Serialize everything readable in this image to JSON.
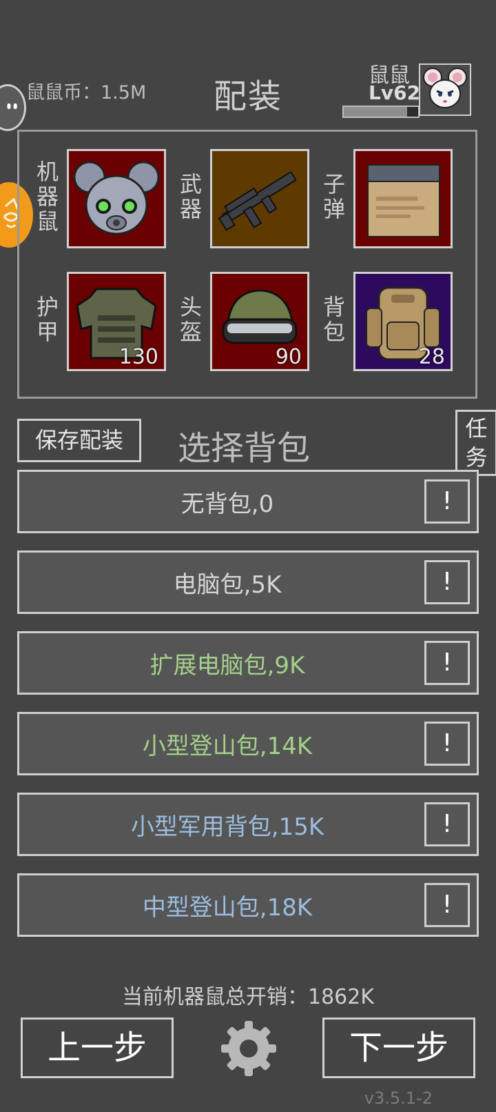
{
  "header": {
    "coins_label": "鼠鼠币：1.5M",
    "title": "配装",
    "player_name": "鼠鼠",
    "player_level": "Lv62",
    "xp_progress": 0.85
  },
  "loadout": {
    "slots": [
      {
        "label": "机器鼠",
        "icon": "robot-mouse-head-icon",
        "bg": "#6b0000",
        "count": ""
      },
      {
        "label": "武器",
        "icon": "assault-rifle-icon",
        "bg": "#5e3a00",
        "count": ""
      },
      {
        "label": "子弹",
        "icon": "ammo-box-icon",
        "bg": "#6b0000",
        "count": ""
      },
      {
        "label": "护甲",
        "icon": "body-armor-icon",
        "bg": "#6b0000",
        "count": "130"
      },
      {
        "label": "头盔",
        "icon": "helmet-icon",
        "bg": "#6b0000",
        "count": "90"
      },
      {
        "label": "背包",
        "icon": "backpack-icon",
        "bg": "#2d0a5e",
        "count": "28"
      }
    ]
  },
  "controls": {
    "save_label": "保存配装",
    "section_title": "选择背包",
    "task_label": "任务"
  },
  "backpacks": [
    {
      "label": "无背包,0",
      "color": "#d6d6d6",
      "info": "!"
    },
    {
      "label": "电脑包,5K",
      "color": "#d6d6d6",
      "info": "!"
    },
    {
      "label": "扩展电脑包,9K",
      "color": "#a4d08a",
      "info": "!"
    },
    {
      "label": "小型登山包,14K",
      "color": "#a4d08a",
      "info": "!"
    },
    {
      "label": "小型军用背包,15K",
      "color": "#9bbde0",
      "info": "!"
    },
    {
      "label": "中型登山包,18K",
      "color": "#9bbde0",
      "info": "!"
    }
  ],
  "footer": {
    "total_cost": "当前机器鼠总开销：1862K",
    "prev_label": "上一步",
    "next_label": "下一步",
    "version": "v3.5.1-2"
  }
}
